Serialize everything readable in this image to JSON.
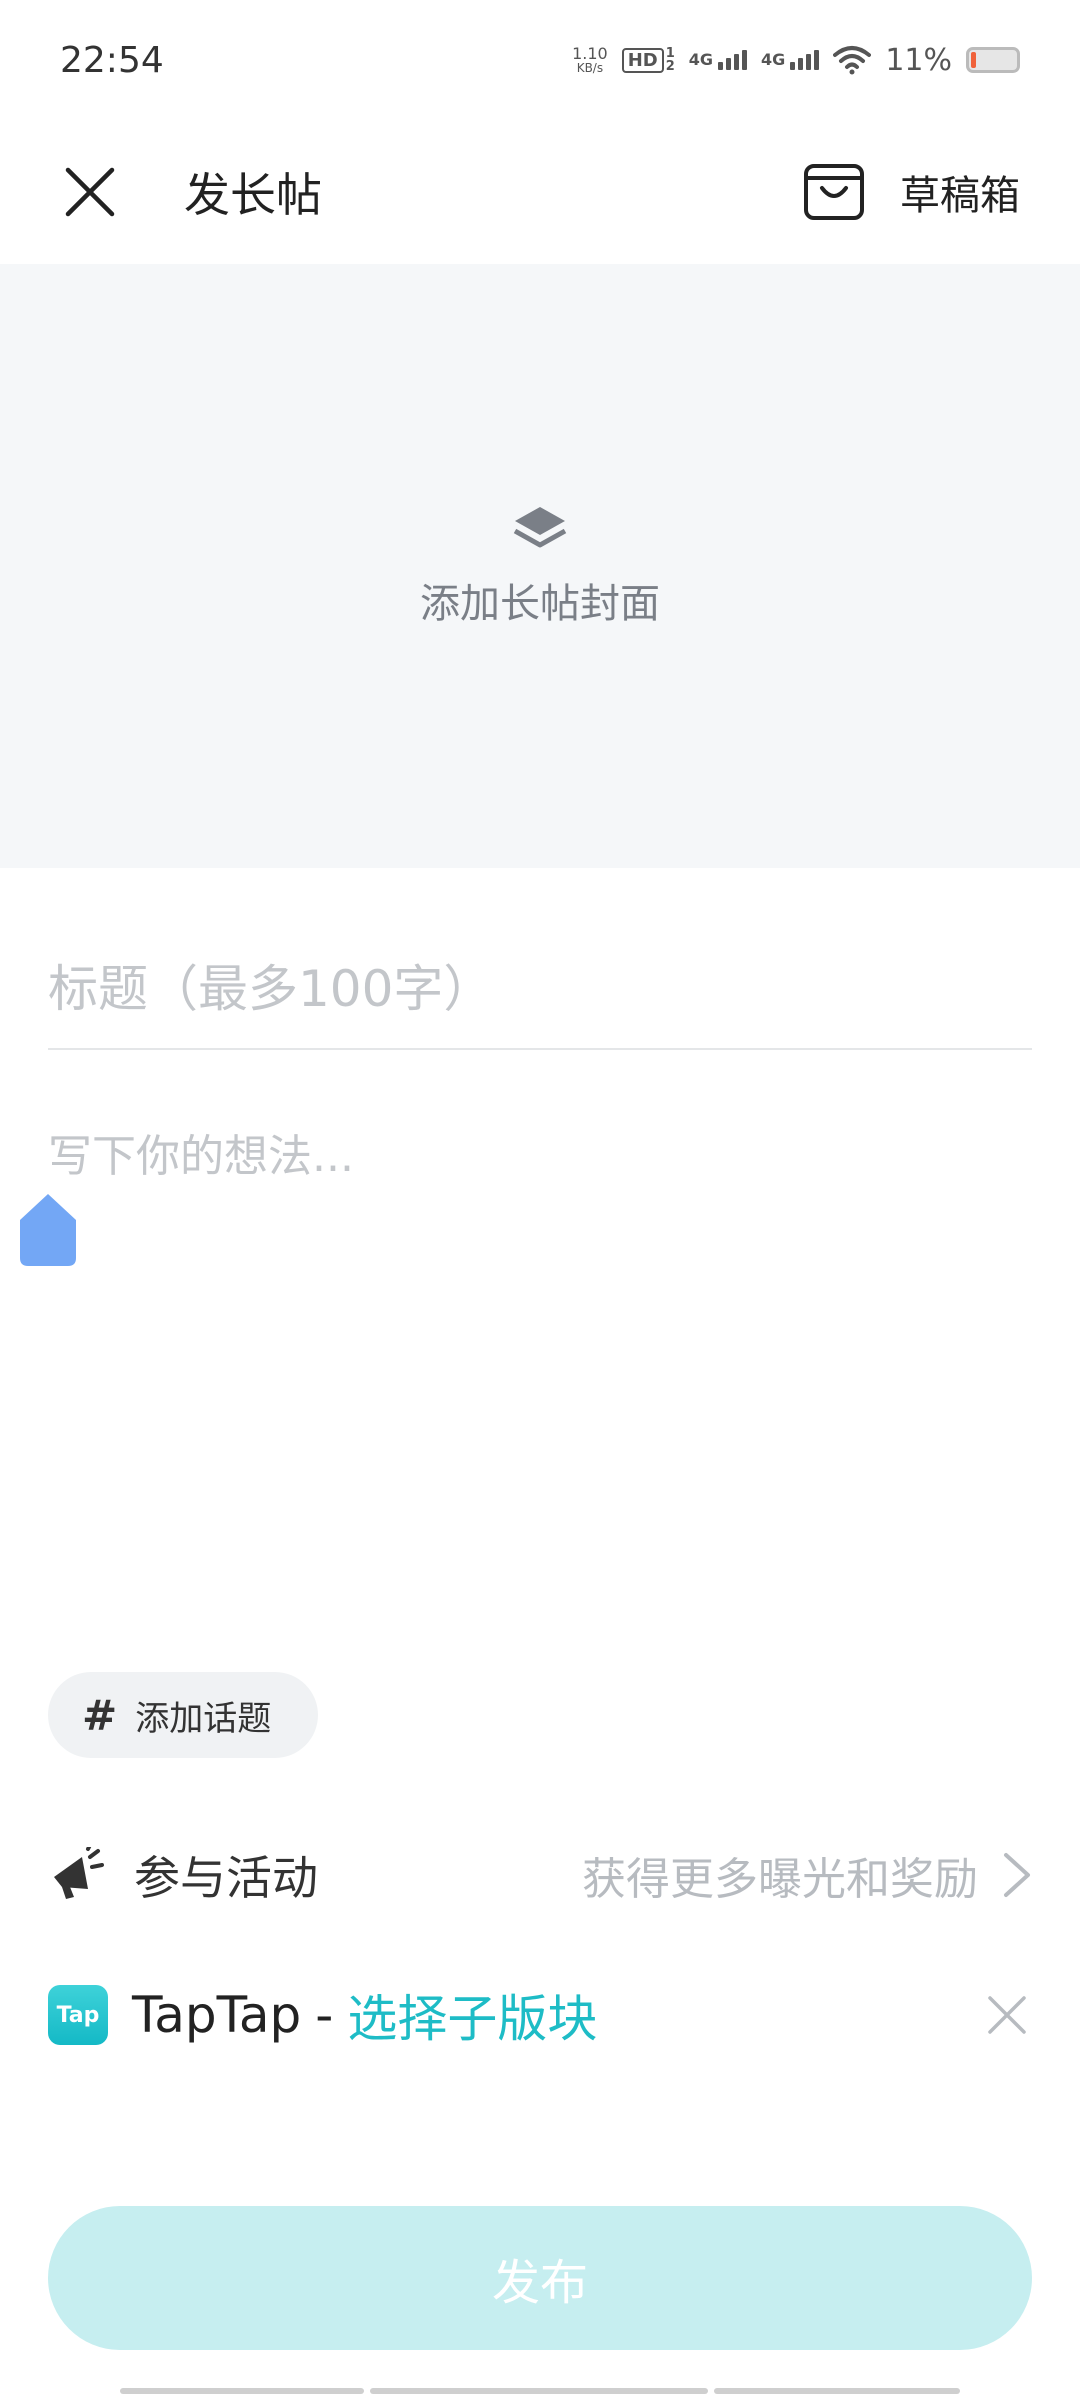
{
  "status": {
    "time": "22:54",
    "net_speed_value": "1.10",
    "net_speed_unit": "KB/s",
    "hd_badge": "HD",
    "hd_sub_top": "1",
    "hd_sub_bottom": "2",
    "signal1_label": "4G",
    "signal2_label": "4G",
    "battery_percent": "11%",
    "battery_level": 0.11
  },
  "header": {
    "title": "发长帖",
    "drafts_label": "草稿箱"
  },
  "cover": {
    "label": "添加长帖封面"
  },
  "editor": {
    "title_placeholder": "标题（最多100字）",
    "body_placeholder": "写下你的想法..."
  },
  "topic": {
    "hash": "#",
    "label": "添加话题"
  },
  "activity": {
    "label": "参与活动",
    "hint": "获得更多曝光和奖励"
  },
  "section": {
    "logo_text": "Tap",
    "app_name": "TapTap",
    "separator": "-",
    "choose_label": "选择子版块"
  },
  "publish": {
    "label": "发布"
  },
  "colors": {
    "accent": "#1ebcc6",
    "publish_disabled": "#c6eef0",
    "cover_bg": "#f5f7f9",
    "cursor_handle": "#73a7f5"
  }
}
